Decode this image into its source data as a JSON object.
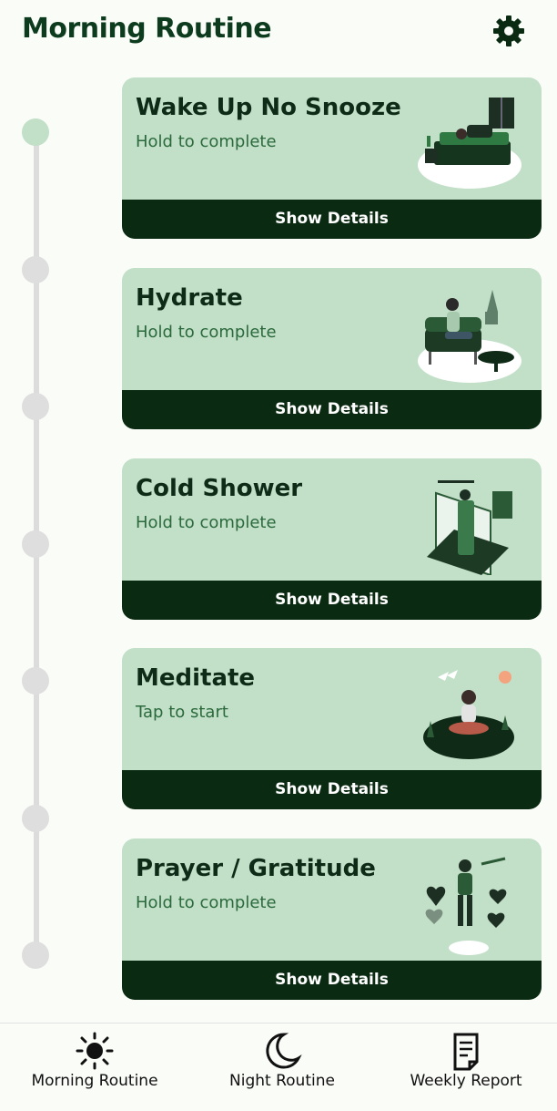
{
  "header": {
    "title": "Morning Routine",
    "settings_icon": "gear-icon"
  },
  "tasks": [
    {
      "title": "Wake Up No Snooze",
      "subtitle": "Hold to complete",
      "button": "Show Details",
      "illustration": "bed-sleep-icon",
      "done": true
    },
    {
      "title": "Hydrate",
      "subtitle": "Hold to complete",
      "button": "Show Details",
      "illustration": "sofa-tea-icon",
      "done": false
    },
    {
      "title": "Cold Shower",
      "subtitle": "Hold to complete",
      "button": "Show Details",
      "illustration": "shower-icon",
      "done": false
    },
    {
      "title": "Meditate",
      "subtitle": "Tap to start",
      "button": "Show Details",
      "illustration": "meditation-icon",
      "done": false
    },
    {
      "title": "Prayer / Gratitude",
      "subtitle": "Hold to complete",
      "button": "Show Details",
      "illustration": "gratitude-icon",
      "done": false
    }
  ],
  "nav": [
    {
      "label": "Morning Routine",
      "icon": "sun-icon"
    },
    {
      "label": "Night Routine",
      "icon": "moon-icon"
    },
    {
      "label": "Weekly Report",
      "icon": "report-icon"
    }
  ],
  "colors": {
    "card_bg": "#c2dfc8",
    "button_bg": "#0b2a12",
    "title": "#0d3b1e",
    "timeline": "#dcdcdc"
  }
}
